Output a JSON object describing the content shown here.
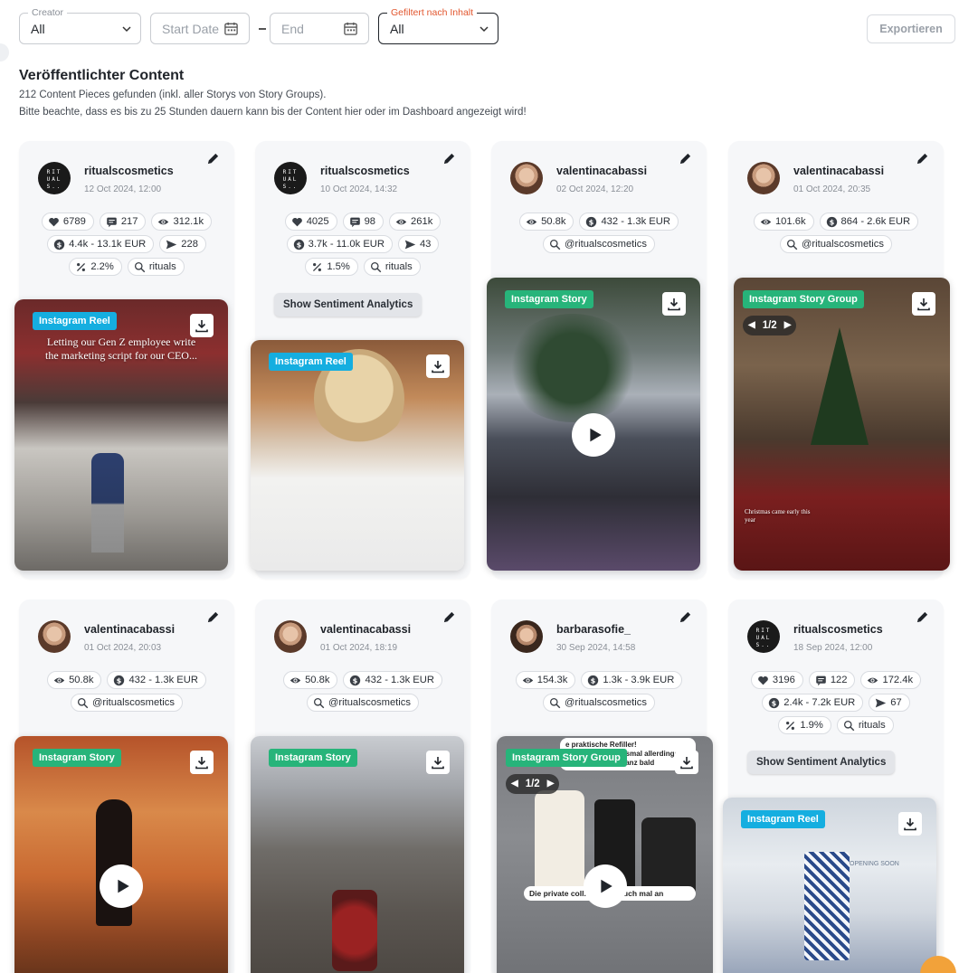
{
  "filters": {
    "creator": {
      "label": "Creator",
      "value": "All"
    },
    "start_date": {
      "placeholder": "Start Date"
    },
    "end_date": {
      "placeholder": "End"
    },
    "content_filter": {
      "label": "Gefiltert nach Inhalt",
      "value": "All"
    },
    "export_label": "Exportieren"
  },
  "header": {
    "title": "Veröffentlichter Content",
    "count_text": "212 Content Pieces gefunden (inkl. aller Storys von Story Groups).",
    "notice_text": "Bitte beachte, dass es bis zu 25 Stunden dauern kann bis der Content hier oder im Dashboard angezeigt wird!"
  },
  "sentiment_label": "Show Sentiment Analytics",
  "cards": [
    {
      "username": "ritualscosmetics",
      "date": "12 Oct 2024, 12:00",
      "likes": "6789",
      "comments": "217",
      "views": "312.1k",
      "value": "4.4k - 13.1k EUR",
      "shares": "228",
      "rate": "2.2%",
      "tag": "rituals",
      "type": "Instagram Reel",
      "overlay_text": "Letting our Gen Z employee write the marketing script for our CEO..."
    },
    {
      "username": "ritualscosmetics",
      "date": "10 Oct 2024, 14:32",
      "likes": "4025",
      "comments": "98",
      "views": "261k",
      "value": "3.7k - 11.0k EUR",
      "shares": "43",
      "rate": "1.5%",
      "tag": "rituals",
      "type": "Instagram Reel"
    },
    {
      "username": "valentinacabassi",
      "date": "02 Oct 2024, 12:20",
      "views": "50.8k",
      "value": "432 - 1.3k EUR",
      "tag": "@ritualscosmetics",
      "type": "Instagram Story"
    },
    {
      "username": "valentinacabassi",
      "date": "01 Oct 2024, 20:35",
      "views": "101.6k",
      "value": "864 - 2.6k EUR",
      "tag": "@ritualscosmetics",
      "type": "Instagram Story Group",
      "pager": "1/2",
      "overlay_text": "Christmas came early this year"
    },
    {
      "username": "valentinacabassi",
      "date": "01 Oct 2024, 20:03",
      "views": "50.8k",
      "value": "432 - 1.3k EUR",
      "tag": "@ritualscosmetics",
      "type": "Instagram Story"
    },
    {
      "username": "valentinacabassi",
      "date": "01 Oct 2024, 18:19",
      "views": "50.8k",
      "value": "432 - 1.3k EUR",
      "tag": "@ritualscosmetics",
      "type": "Instagram Story"
    },
    {
      "username": "barbarasofie_",
      "date": "30 Sep 2024, 14:58",
      "views": "154.3k",
      "value": "1.3k - 3.9k EUR",
      "tag": "@ritualscosmetics",
      "type": "Instagram Story Group",
      "pager": "1/2",
      "caption_top": "e praktische Refiller! Nachfüllpackung smal allerdings warum, seht ihr ganz bald",
      "caption_bottom": "Die private coll... aut sie euch mal an"
    },
    {
      "username": "ritualscosmetics",
      "date": "18 Sep 2024, 12:00",
      "likes": "3196",
      "comments": "122",
      "views": "172.4k",
      "value": "2.4k - 7.2k EUR",
      "shares": "67",
      "rate": "1.9%",
      "tag": "rituals",
      "type": "Instagram Reel",
      "overlay_text": "OPENING SOON"
    }
  ],
  "colors": {
    "reel_badge": "#15aee0",
    "story_badge": "#27b47a",
    "active_filter_label": "#e2562e",
    "card_bg": "#f6f7f9"
  },
  "icons": [
    "chevron-down-icon",
    "calendar-icon",
    "pencil-icon",
    "heart-icon",
    "comment-icon",
    "eye-icon",
    "dollar-icon",
    "share-icon",
    "percent-icon",
    "search-icon",
    "download-icon",
    "play-icon"
  ]
}
